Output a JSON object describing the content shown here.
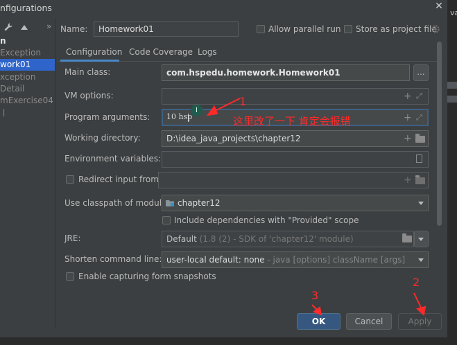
{
  "window": {
    "title": "nfigurations",
    "close_glyph": "✕",
    "edge_text": "va"
  },
  "left_panel": {
    "items": [
      {
        "label": "n",
        "selected": false,
        "bold": true
      },
      {
        "label": "Exception",
        "selected": false
      },
      {
        "label": "work01",
        "selected": true
      },
      {
        "label": "xception",
        "selected": false
      },
      {
        "label": "Detail",
        "selected": false
      },
      {
        "label": "mExercise04",
        "selected": false
      },
      {
        "label": "ㅣ",
        "selected": false
      }
    ],
    "toolbar": {
      "wrench_icon": "wrench-icon",
      "arrow_up_icon": "arrow-up-icon",
      "expand_icon": "double-chevron-right-icon",
      "expand_glyph": "»"
    }
  },
  "header": {
    "name_label": "Name:",
    "name_value": "Homework01",
    "allow_parallel_label": "Allow parallel run",
    "store_project_label": "Store as project file",
    "gear_icon": "gear-icon"
  },
  "tabs": [
    {
      "label": "Configuration",
      "active": true
    },
    {
      "label": "Code Coverage",
      "active": false
    },
    {
      "label": "Logs",
      "active": false
    }
  ],
  "form": {
    "main_class_label": "Main class:",
    "main_class_value": "com.hspedu.homework.Homework01",
    "browse_glyph": "...",
    "vm_options_label": "VM options:",
    "vm_options_value": "",
    "program_args_label": "Program arguments:",
    "program_args_value": "10 hsp",
    "working_dir_label": "Working directory:",
    "working_dir_value": "D:\\idea_java_projects\\chapter12",
    "env_vars_label": "Environment variables:",
    "env_vars_value": "",
    "redirect_label": "Redirect input from:",
    "redirect_value": "",
    "classpath_label": "Use classpath of module:",
    "classpath_value": "chapter12",
    "include_deps_label": "Include dependencies with \"Provided\" scope",
    "jre_label": "JRE:",
    "jre_value_main": "Default",
    "jre_value_detail": " (1.8 (2) - SDK of 'chapter12' module)",
    "shorten_label": "Shorten command line:",
    "shorten_value_main": "user-local default: none",
    "shorten_value_detail": " - java [options] className [args]",
    "snapshots_label": "Enable capturing form snapshots",
    "plus_glyph": "+",
    "expand_glyph": "⤢"
  },
  "annotations": {
    "note_1_number": "1",
    "note_1_text": "这里改了一下 肯定会报错",
    "note_2_number": "2",
    "note_3_number": "3",
    "color": "#ff2a2a"
  },
  "buttons": {
    "ok": "OK",
    "cancel": "Cancel",
    "apply": "Apply"
  },
  "colors": {
    "accent": "#365880",
    "selection": "#2f65ca",
    "focus_border": "#3d6185",
    "tab_underline": "#4a88c7"
  }
}
